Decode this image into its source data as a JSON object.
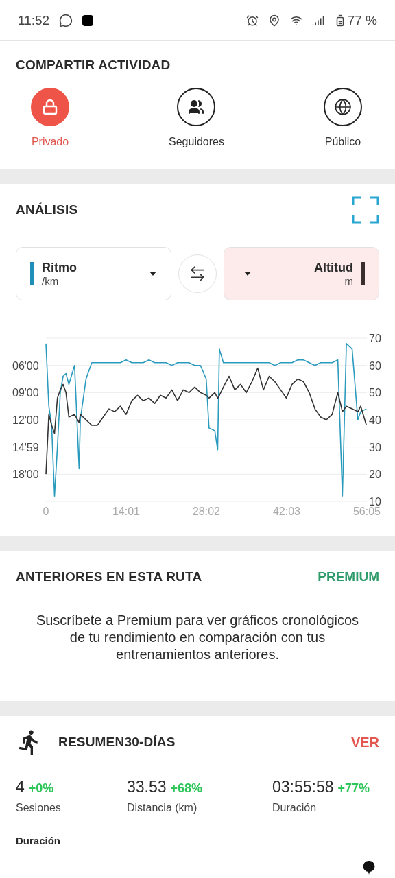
{
  "status_bar": {
    "time": "11:52",
    "battery": "77 %"
  },
  "share": {
    "title": "COMPARTIR ACTIVIDAD",
    "options": [
      {
        "label": "Privado",
        "kind": "lock",
        "selected": true
      },
      {
        "label": "Seguidores",
        "kind": "people",
        "selected": false
      },
      {
        "label": "Público",
        "kind": "globe",
        "selected": false
      }
    ]
  },
  "analysis": {
    "title": "ANÁLISIS",
    "left_metric": {
      "unit": "/km",
      "color": "#1f8fb8"
    },
    "right_metric": {
      "unit": "m",
      "color": "#3a2e2e"
    },
    "pace_labels": [
      "06'00",
      "09'00",
      "12'00",
      "14'59",
      "18'00"
    ],
    "chart_data": {
      "type": "line",
      "grid": true,
      "xlim": [
        0,
        56.08
      ],
      "ylim": [
        10,
        70
      ],
      "x": [
        0,
        0.5,
        1,
        1.5,
        2,
        2.5,
        3,
        3.5,
        4,
        5,
        5.8,
        6,
        7,
        8,
        9,
        10,
        11,
        12,
        13,
        14,
        15,
        16,
        17,
        18,
        19,
        20,
        21,
        22,
        23,
        24,
        25,
        26,
        27,
        28,
        28.5,
        29.5,
        30,
        30.3,
        31,
        32,
        33,
        34,
        35,
        36,
        37,
        38,
        39,
        40,
        41,
        42,
        43,
        44,
        45,
        46,
        47,
        48,
        49,
        50,
        51,
        51.8,
        52.5,
        53.5,
        54.5,
        55,
        56
      ],
      "xticks": [
        {
          "value": 0,
          "label": "0"
        },
        {
          "value": 14.02,
          "label": "14:01"
        },
        {
          "value": 28.03,
          "label": "28:02"
        },
        {
          "value": 42.05,
          "label": "42:03"
        },
        {
          "value": 56.08,
          "label": "56:05"
        }
      ],
      "yticks": [
        70,
        60,
        50,
        40,
        30,
        20,
        10
      ],
      "series": [
        {
          "name": "Ritmo",
          "color": "#2a9bbd",
          "values": [
            68,
            45,
            38,
            12,
            30,
            50,
            56,
            57,
            53,
            60,
            22,
            40,
            55,
            61,
            61,
            61,
            61,
            61,
            61,
            62,
            61,
            61,
            61,
            62,
            61,
            61,
            61,
            60,
            61,
            61,
            61,
            60,
            60,
            55,
            37,
            36,
            29,
            66,
            61,
            61,
            61,
            61,
            61,
            61,
            61,
            61,
            61,
            60,
            61,
            61,
            61,
            62,
            62,
            61,
            60,
            61,
            61,
            61,
            62,
            12,
            68,
            66,
            40,
            43,
            44
          ]
        },
        {
          "name": "Altitud",
          "color": "#333333",
          "values": [
            20,
            42,
            38,
            35,
            48,
            51,
            53,
            50,
            41,
            42,
            39,
            42,
            40,
            38,
            38,
            41,
            44,
            43,
            45,
            42,
            47,
            49,
            47,
            48,
            46,
            49,
            48,
            51,
            47,
            51,
            50,
            52,
            50,
            49,
            48,
            50,
            48,
            49,
            52,
            56,
            51,
            53,
            50,
            54,
            59,
            51,
            56,
            54,
            51,
            48,
            53,
            55,
            54,
            50,
            44,
            41,
            40,
            42,
            50,
            43,
            45,
            44,
            43,
            45,
            38
          ]
        }
      ]
    }
  },
  "previous": {
    "title": "ANTERIORES EN ESTA RUTA",
    "badge": "PREMIUM",
    "message": "Suscríbete a Premium para ver gráficos cronológicos de tu rendimiento en comparación con tus entrenamientos anteriores."
  },
  "summary": {
    "title": "RESUMEN30-DÍAS",
    "action": "VER",
    "stats": [
      {
        "value": "4",
        "delta": "+0%",
        "label": "Sesiones"
      },
      {
        "value": "33.53",
        "delta": "+68%",
        "label": "Distancia (km)"
      },
      {
        "value": "03:55:58",
        "delta": "+77%",
        "label": "Duración"
      }
    ],
    "subheading": "Duración"
  }
}
